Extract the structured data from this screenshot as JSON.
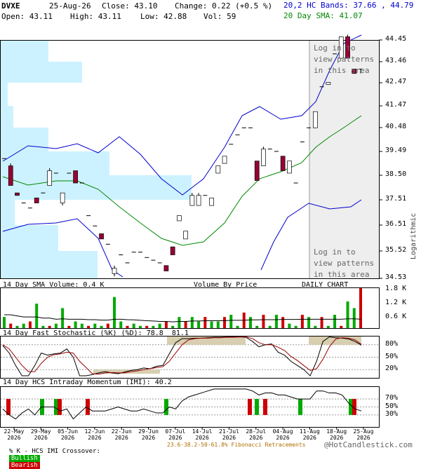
{
  "header": {
    "symbol": "DVXE",
    "date": "25-Aug-26",
    "close": "Close: 43.10",
    "change": "Change: 0.22 (+0.5 %)",
    "bands": "20,2 HC Bands: 37.66 , 44.79",
    "sma": "20 Day SMA: 41.07",
    "open": "Open: 43.11",
    "high": "High: 43.11",
    "low": "Low: 42.88",
    "vol": "Vol: 59"
  },
  "colors": {
    "bands": "#0000cc",
    "sma": "#008800",
    "bullish": "#00aa00",
    "bearish": "#cc0000",
    "candle_down": "#990033",
    "vbp": "#ccf2ff",
    "shade": "#eeeeee",
    "stoch_fill": "#d8ceb0"
  },
  "texts": {
    "login_top": "Log in to\nview patterns\nin this area",
    "login_bottom": "Log in to\nview patterns\nin this area",
    "logarithmic": "Logarithmic",
    "vol_title": "14 Day SMA Volume: 0.4 K",
    "vbp_title": "Volume By Price",
    "daily": "DAILY CHART",
    "stoch_title": "14 Day Fast Stochastic (%K) (%D): 78.8  81.1",
    "imi_title": "14 Day HCS Intraday Momentum (IMI): 40.2",
    "footer_left": "% K - HCS IMI Crossover:",
    "bullish": "Bullish",
    "bearish": "Bearish",
    "fib": "23.6-38.2-50-61.8% Fibonacci Retracements",
    "copyright": "@HotCandlestick.com"
  },
  "chart_data": {
    "type": "candlestick",
    "y_scale": "log",
    "ylim": [
      34.53,
      44.45
    ],
    "y_ticks": [
      "44.45",
      "43.46",
      "42.47",
      "41.47",
      "40.48",
      "39.49",
      "38.50",
      "37.51",
      "36.51",
      "35.52",
      "34.53"
    ],
    "x_tick_labels": [
      {
        "d": "22-May",
        "y": "2026"
      },
      {
        "d": "29-May",
        "y": "2026"
      },
      {
        "d": "05-Jun",
        "y": "2026"
      },
      {
        "d": "12-Jun",
        "y": "2026"
      },
      {
        "d": "22-Jun",
        "y": "2026"
      },
      {
        "d": "29-Jun",
        "y": "2026"
      },
      {
        "d": "07-Jul",
        "y": "2026"
      },
      {
        "d": "14-Jul",
        "y": "2026"
      },
      {
        "d": "21-Jul",
        "y": "2026"
      },
      {
        "d": "28-Jul",
        "y": "2026"
      },
      {
        "d": "04-Aug",
        "y": "2026"
      },
      {
        "d": "11-Aug",
        "y": "2026"
      },
      {
        "d": "18-Aug",
        "y": "2026"
      },
      {
        "d": "25-Aug",
        "y": "2026"
      }
    ],
    "candles": [
      [
        39.2,
        39.2,
        39.2,
        39.2
      ],
      [
        38.9,
        39.0,
        38.1,
        38.1
      ],
      [
        37.8,
        37.8,
        37.7,
        37.7
      ],
      [
        37.4,
        37.4,
        37.4,
        37.4
      ],
      [
        37.2,
        37.2,
        37.2,
        37.2
      ],
      [
        37.6,
        37.6,
        37.4,
        37.4
      ],
      [
        37.8,
        37.8,
        37.8,
        37.8
      ],
      [
        38.1,
        38.8,
        38.1,
        38.7
      ],
      [
        38.6,
        38.6,
        38.6,
        38.6
      ],
      [
        37.4,
        37.8,
        37.3,
        37.8
      ],
      [
        38.6,
        38.6,
        38.6,
        38.6
      ],
      [
        38.7,
        38.7,
        38.2,
        38.2
      ],
      [
        38.2,
        38.2,
        38.2,
        38.2
      ],
      [
        36.9,
        36.9,
        36.9,
        36.9
      ],
      [
        36.5,
        36.5,
        36.5,
        36.5
      ],
      [
        36.2,
        36.2,
        36.0,
        36.0
      ],
      [
        35.8,
        35.8,
        35.8,
        35.8
      ],
      [
        34.7,
        35.0,
        34.6,
        34.9
      ],
      [
        35.4,
        35.4,
        35.4,
        35.4
      ],
      [
        35.1,
        35.1,
        35.1,
        35.1
      ],
      [
        35.5,
        35.5,
        35.5,
        35.5
      ],
      [
        35.5,
        35.5,
        35.5,
        35.5
      ],
      [
        35.3,
        35.3,
        35.3,
        35.3
      ],
      [
        35.2,
        35.2,
        35.2,
        35.2
      ],
      [
        35.1,
        35.1,
        35.1,
        35.1
      ],
      [
        35.0,
        35.0,
        34.8,
        34.8
      ],
      [
        35.7,
        35.7,
        35.4,
        35.4
      ],
      [
        36.7,
        36.9,
        36.7,
        36.9
      ],
      [
        36.0,
        36.3,
        36.0,
        36.3
      ],
      [
        37.3,
        37.8,
        37.3,
        37.7
      ],
      [
        37.3,
        37.8,
        37.3,
        37.7
      ],
      [
        37.7,
        37.7,
        37.7,
        37.7
      ],
      [
        37.3,
        37.6,
        37.3,
        37.6
      ],
      [
        38.6,
        38.9,
        38.6,
        38.9
      ],
      [
        39.0,
        39.3,
        39.0,
        39.3
      ],
      [
        39.8,
        39.8,
        39.8,
        39.8
      ],
      [
        40.2,
        40.2,
        40.2,
        40.2
      ],
      [
        40.5,
        40.5,
        40.5,
        40.5
      ],
      [
        40.5,
        40.5,
        40.5,
        40.5
      ],
      [
        39.1,
        39.1,
        38.3,
        38.3
      ],
      [
        38.9,
        39.7,
        38.9,
        39.6
      ],
      [
        39.6,
        39.6,
        39.6,
        39.6
      ],
      [
        39.5,
        39.5,
        39.5,
        39.5
      ],
      [
        39.3,
        39.3,
        38.7,
        38.7
      ],
      [
        38.6,
        39.1,
        38.6,
        39.1
      ],
      [
        38.2,
        38.2,
        38.2,
        38.2
      ],
      [
        39.9,
        39.9,
        39.9,
        39.9
      ],
      [
        40.5,
        40.5,
        40.5,
        40.5
      ],
      [
        40.5,
        41.2,
        40.5,
        41.2
      ],
      [
        42.3,
        42.3,
        42.3,
        42.3
      ],
      [
        42.4,
        42.5,
        42.4,
        42.5
      ],
      [
        43.8,
        43.8,
        43.8,
        43.8
      ],
      [
        43.6,
        44.6,
        43.6,
        44.6
      ],
      [
        44.6,
        44.7,
        43.6,
        43.6
      ],
      [
        43.1,
        43.1,
        42.9,
        42.9
      ],
      [
        43.1,
        43.1,
        42.9,
        43.1
      ]
    ],
    "volume": {
      "ticks": [
        "1.8 K",
        "1.2 K",
        "0.6 K"
      ],
      "max": 1.8,
      "values": [
        0.5,
        0.2,
        0.1,
        0.2,
        0.3,
        1.1,
        0.1,
        0.1,
        0.2,
        0.9,
        0.1,
        0.3,
        0.2,
        0.1,
        0.2,
        0.1,
        0.2,
        1.4,
        0.3,
        0.1,
        0.2,
        0.1,
        0.1,
        0.1,
        0.2,
        0.3,
        0.1,
        0.5,
        0.3,
        0.5,
        0.3,
        0.5,
        0.3,
        0.3,
        0.5,
        0.6,
        0.1,
        0.7,
        0.5,
        0.1,
        0.6,
        0.1,
        0.6,
        0.5,
        0.2,
        0.1,
        0.6,
        0.5,
        0.1,
        0.5,
        0.1,
        0.6,
        0.1,
        1.2,
        0.9,
        1.8
      ],
      "sma": [
        0.6,
        0.6,
        0.55,
        0.5,
        0.5,
        0.5,
        0.45,
        0.45,
        0.4,
        0.42,
        0.4,
        0.4,
        0.4,
        0.38,
        0.38,
        0.36,
        0.36,
        0.4,
        0.4,
        0.38,
        0.37,
        0.35,
        0.33,
        0.32,
        0.3,
        0.3,
        0.28,
        0.3,
        0.3,
        0.32,
        0.32,
        0.33,
        0.33,
        0.33,
        0.33,
        0.35,
        0.35,
        0.35,
        0.37,
        0.37,
        0.38,
        0.38,
        0.38,
        0.39,
        0.39,
        0.39,
        0.4,
        0.4,
        0.4,
        0.4,
        0.4,
        0.4,
        0.4,
        0.42,
        0.42,
        0.4
      ]
    },
    "stochastic": {
      "ticks": [
        "80%",
        "50%",
        "20%"
      ],
      "k": [
        78,
        60,
        30,
        5,
        5,
        30,
        60,
        55,
        58,
        60,
        70,
        50,
        5,
        5,
        8,
        12,
        15,
        12,
        10,
        14,
        18,
        20,
        24,
        22,
        28,
        30,
        58,
        85,
        95,
        95,
        96,
        96,
        97,
        98,
        98,
        99,
        99,
        99,
        98,
        88,
        75,
        80,
        82,
        62,
        55,
        40,
        30,
        20,
        5,
        40,
        88,
        99,
        97,
        96,
        94,
        88,
        79
      ],
      "d": [
        80,
        70,
        50,
        30,
        15,
        15,
        35,
        50,
        56,
        58,
        62,
        60,
        40,
        25,
        10,
        9,
        12,
        13,
        12,
        12,
        15,
        17,
        20,
        22,
        25,
        27,
        40,
        60,
        80,
        92,
        95,
        96,
        96,
        97,
        97,
        98,
        98,
        99,
        99,
        95,
        85,
        80,
        80,
        74,
        66,
        52,
        42,
        30,
        18,
        22,
        45,
        75,
        94,
        97,
        96,
        92,
        81
      ]
    },
    "imi": {
      "ticks": [
        "70%",
        "50%",
        "30%"
      ],
      "values": [
        45,
        30,
        20,
        35,
        45,
        30,
        50,
        50,
        50,
        40,
        45,
        20,
        35,
        50,
        40,
        40,
        40,
        45,
        50,
        45,
        40,
        40,
        45,
        40,
        35,
        35,
        50,
        45,
        65,
        75,
        80,
        85,
        90,
        95,
        95,
        95,
        95,
        95,
        95,
        90,
        80,
        85,
        85,
        80,
        80,
        75,
        70,
        70,
        70,
        90,
        90,
        85,
        85,
        80,
        60,
        45,
        40
      ],
      "bars": [
        {
          "i": 1,
          "c": "bearish"
        },
        {
          "i": 7,
          "c": "bullish"
        },
        {
          "i": 10,
          "c": "bullish"
        },
        {
          "i": 11,
          "c": "bearish"
        },
        {
          "i": 16,
          "c": "bearish"
        },
        {
          "i": 29,
          "c": "bullish"
        },
        {
          "i": 44,
          "c": "bearish"
        },
        {
          "i": 45,
          "c": "bullish"
        },
        {
          "i": 46,
          "c": "bearish"
        },
        {
          "i": 48,
          "c": "bullish"
        },
        {
          "i": 52,
          "c": "bullish"
        },
        {
          "i": 62,
          "c": "bearish"
        }
      ]
    }
  }
}
